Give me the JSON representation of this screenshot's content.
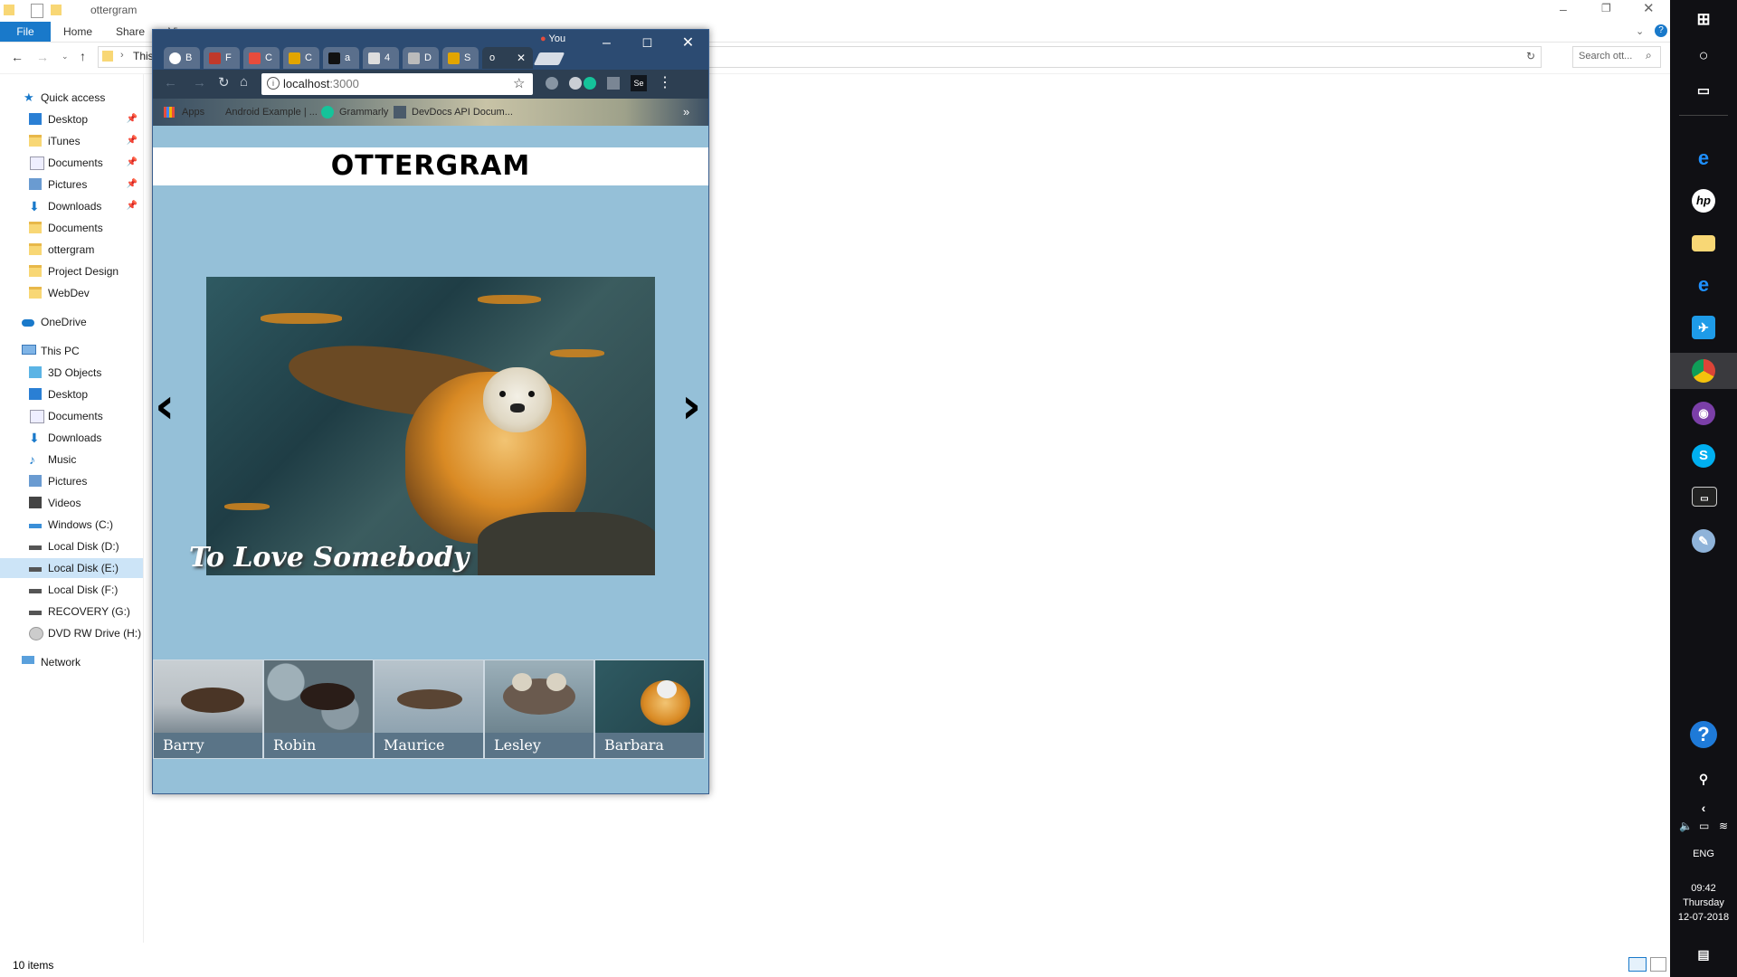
{
  "explorer": {
    "title": "ottergram",
    "ribbon_tabs": [
      "File",
      "Home",
      "Share",
      "View"
    ],
    "address": "This PC",
    "search_placeholder": "Search ott...",
    "quick_access": {
      "label": "Quick access",
      "items": [
        "Desktop",
        "iTunes",
        "Documents",
        "Pictures",
        "Downloads",
        "Documents",
        "ottergram",
        "Project Design",
        "WebDev"
      ]
    },
    "onedrive": "OneDrive",
    "this_pc": {
      "label": "This PC",
      "items": [
        "3D Objects",
        "Desktop",
        "Documents",
        "Downloads",
        "Music",
        "Pictures",
        "Videos",
        "Windows (C:)",
        "Local Disk (D:)",
        "Local Disk (E:)",
        "Local Disk (F:)",
        "RECOVERY (G:)",
        "DVD RW Drive (H:) I"
      ]
    },
    "network": "Network",
    "status": "10 items"
  },
  "chrome": {
    "profile": "You",
    "tabs": [
      {
        "label": "B",
        "icon": "github-icon",
        "color": "#ffffff"
      },
      {
        "label": "F",
        "icon": "fcc-icon",
        "color": "#c0392b"
      },
      {
        "label": "C",
        "icon": "gmail-icon",
        "color": "#e74c3c"
      },
      {
        "label": "C",
        "icon": "slack-icon",
        "color": "#e2a500"
      },
      {
        "label": "a",
        "icon": "medium-icon",
        "color": "#111111"
      },
      {
        "label": "4",
        "icon": "doc-icon",
        "color": "#dddddd"
      },
      {
        "label": "D",
        "icon": "person-icon",
        "color": "#bbbbbb"
      },
      {
        "label": "S",
        "icon": "slack-icon",
        "color": "#e2a500"
      },
      {
        "label": "o",
        "icon": "page-icon",
        "color": "#ffffff"
      }
    ],
    "url": "localhost",
    "url_port": ":3000",
    "bookmarks": [
      "Apps",
      "Android Example | ...",
      "Grammarly",
      "DevDocs API Docum..."
    ],
    "bookmarks_more": "»"
  },
  "page": {
    "title": "OTTERGRAM",
    "caption": "To Love Somebody",
    "prev": "‹",
    "next": "›",
    "thumbnails": [
      "Barry",
      "Robin",
      "Maurice",
      "Lesley",
      "Barbara"
    ]
  },
  "taskbar": {
    "language": "ENG",
    "time": "09:42",
    "day": "Thursday",
    "date": "12-07-2018"
  }
}
